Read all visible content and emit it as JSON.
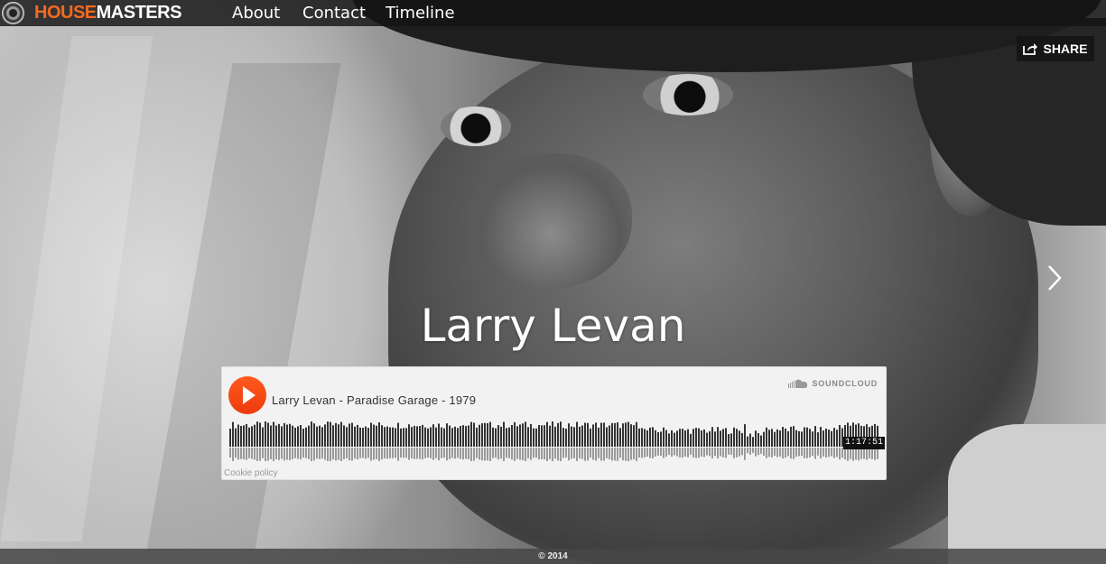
{
  "brand": {
    "name_part1": "HOUSE",
    "name_part2": "MASTERS"
  },
  "nav": {
    "links": [
      "About",
      "Contact",
      "Timeline"
    ]
  },
  "share": {
    "label": "SHARE"
  },
  "hero": {
    "title": "Larry Levan"
  },
  "player": {
    "track_title": "Larry Levan - Paradise Garage - 1979",
    "provider": "SOUNDCLOUD",
    "duration": "1:17:51",
    "cookie_link": "Cookie policy"
  },
  "footer": {
    "copyright": "© 2014"
  },
  "colors": {
    "accent": "#f36a21",
    "play": "#ff5500"
  }
}
